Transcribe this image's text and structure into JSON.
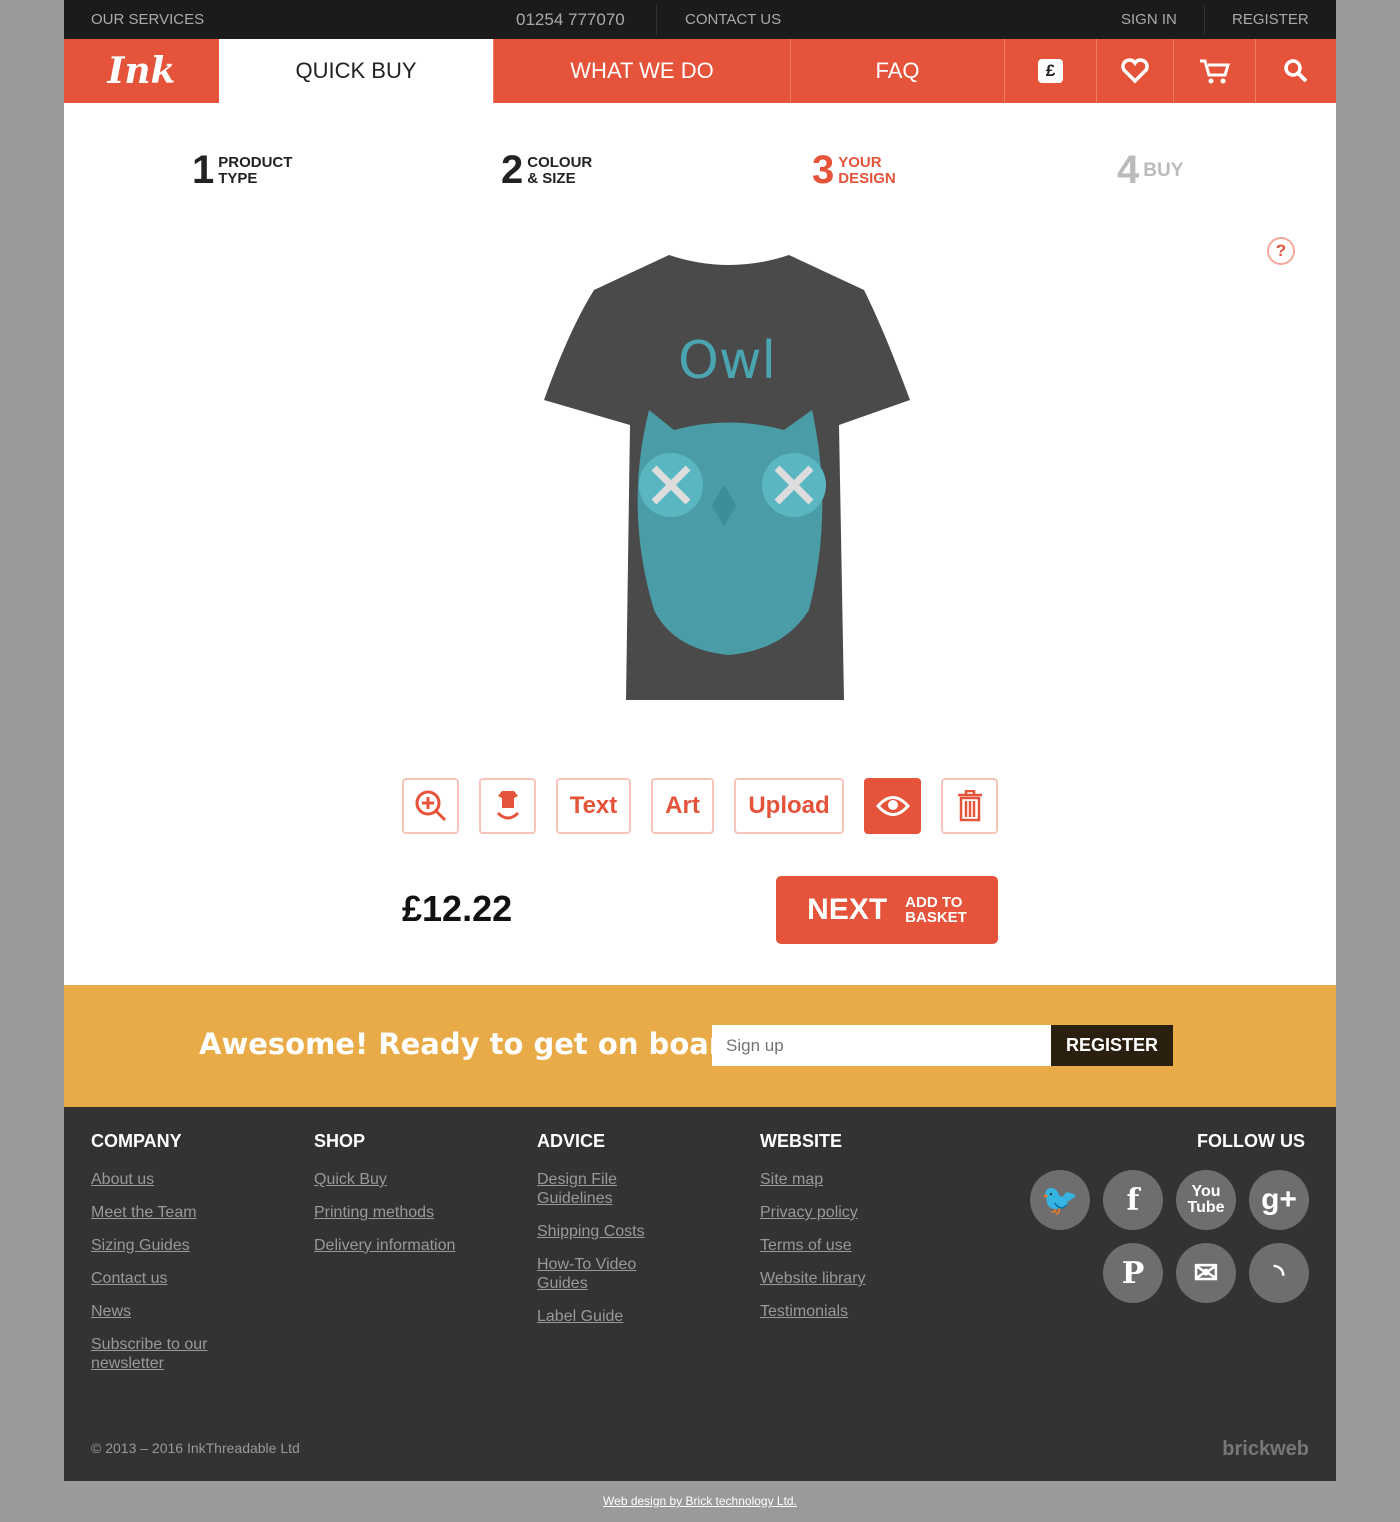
{
  "topbar": {
    "services": "OUR SERVICES",
    "phone": "01254 777070",
    "contact": "CONTACT US",
    "signin": "SIGN IN",
    "register": "REGISTER"
  },
  "nav": {
    "logo": "Ink",
    "quick_buy": "QUICK BUY",
    "what_we_do": "WHAT WE DO",
    "faq": "FAQ",
    "currency": "£"
  },
  "steps": [
    {
      "n": "1",
      "l1": "PRODUCT",
      "l2": "TYPE"
    },
    {
      "n": "2",
      "l1": "COLOUR",
      "l2": "& SIZE"
    },
    {
      "n": "3",
      "l1": "YOUR",
      "l2": "DESIGN"
    },
    {
      "n": "4",
      "l1": "BUY",
      "l2": ""
    }
  ],
  "design": {
    "text": "Owl",
    "shirt_color": "#4a4a4a",
    "print_color": "#4aa5b0"
  },
  "toolbar": {
    "text": "Text",
    "art": "Art",
    "upload": "Upload"
  },
  "price": "£12.22",
  "next": {
    "label": "NEXT",
    "sub1": "ADD TO",
    "sub2": "BASKET"
  },
  "signup": {
    "heading": "Awesome! Ready to get on board?",
    "placeholder": "Sign up",
    "button": "REGISTER"
  },
  "footer": {
    "columns": [
      {
        "title": "COMPANY",
        "links": [
          "About us",
          "Meet the Team",
          "Sizing Guides",
          "Contact us",
          "News",
          "Subscribe to our newsletter"
        ]
      },
      {
        "title": "SHOP",
        "links": [
          "Quick Buy",
          "Printing methods",
          "Delivery information"
        ]
      },
      {
        "title": "ADVICE",
        "links": [
          "Design File Guidelines",
          "Shipping Costs",
          "How-To Video Guides",
          "Label Guide"
        ]
      },
      {
        "title": "WEBSITE",
        "links": [
          "Site map",
          "Privacy policy",
          "Terms of use",
          "Website library",
          "Testimonials"
        ]
      }
    ],
    "follow": "FOLLOW US",
    "copyright": "© 2013 – 2016 InkThreadable Ltd",
    "brand": "brickweb"
  },
  "credit": "Web design by Brick technology Ltd.",
  "colors": {
    "accent": "#e5533a",
    "band": "#e8ab48",
    "footer": "#333333"
  }
}
